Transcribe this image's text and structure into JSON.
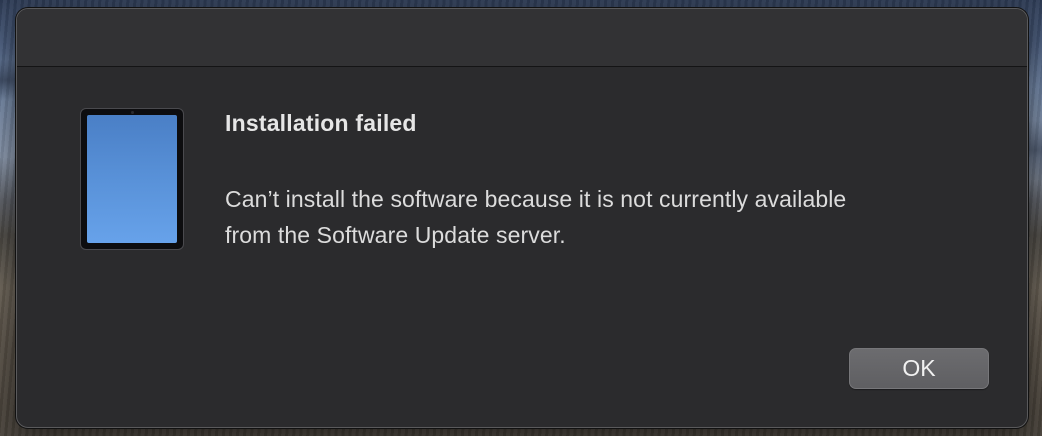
{
  "dialog": {
    "title": "Installation failed",
    "message_line1": "Can’t install the software because it is not currently available",
    "message_line2": "from the Software Update server.",
    "icon": "ipad-device-icon",
    "ok_label": "OK"
  },
  "colors": {
    "dialog_background": "#2b2b2d",
    "titlebar_background": "#323234",
    "button_background": "#6c6c6f",
    "device_screen": "#5a93da"
  }
}
